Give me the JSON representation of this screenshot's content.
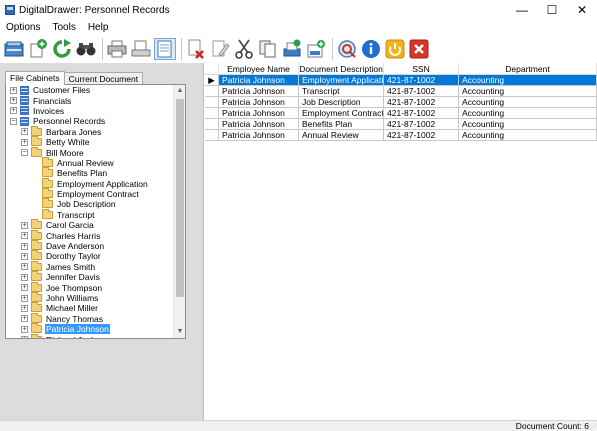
{
  "window": {
    "title": "DigitalDrawer: Personnel Records",
    "minimize": "—",
    "maximize": "☐",
    "close": "✕"
  },
  "menu": [
    "Options",
    "Tools",
    "Help"
  ],
  "toolbar": [
    {
      "name": "open-cabinet-icon",
      "group": 1
    },
    {
      "name": "add-document-icon",
      "group": 1
    },
    {
      "name": "refresh-icon",
      "group": 1
    },
    {
      "name": "binoculars-icon",
      "group": 1
    },
    {
      "name": "print-icon",
      "group": 2
    },
    {
      "name": "scan-icon",
      "group": 2
    },
    {
      "name": "view-document-icon",
      "group": 2,
      "pressed": true
    },
    {
      "name": "delete-document-icon",
      "group": 3
    },
    {
      "name": "edit-document-icon",
      "group": 3
    },
    {
      "name": "cut-icon",
      "group": 3
    },
    {
      "name": "copy-icon",
      "group": 3
    },
    {
      "name": "paste-icon",
      "group": 3
    },
    {
      "name": "add-to-drawer-icon",
      "group": 3
    },
    {
      "name": "settings-icon",
      "group": 4
    },
    {
      "name": "info-icon",
      "group": 4
    },
    {
      "name": "exit-icon",
      "group": 4
    },
    {
      "name": "close-icon",
      "group": 4
    }
  ],
  "tabs": {
    "file_cabinets": "File Cabinets",
    "current_document": "Current Document"
  },
  "tree": [
    {
      "level": 0,
      "type": "cabinet",
      "exp": "+",
      "label": "Customer Files"
    },
    {
      "level": 0,
      "type": "cabinet",
      "exp": "+",
      "label": "Financials"
    },
    {
      "level": 0,
      "type": "cabinet",
      "exp": "+",
      "label": "Invoices"
    },
    {
      "level": 0,
      "type": "cabinet",
      "exp": "−",
      "label": "Personnel Records"
    },
    {
      "level": 1,
      "type": "folder",
      "exp": "+",
      "label": "Barbara Jones"
    },
    {
      "level": 1,
      "type": "folder",
      "exp": "+",
      "label": "Betty White"
    },
    {
      "level": 1,
      "type": "folder",
      "exp": "−",
      "label": "Bill Moore"
    },
    {
      "level": 2,
      "type": "folder",
      "exp": "",
      "label": "Annual Review"
    },
    {
      "level": 2,
      "type": "folder",
      "exp": "",
      "label": "Benefits Plan"
    },
    {
      "level": 2,
      "type": "folder",
      "exp": "",
      "label": "Employment Application"
    },
    {
      "level": 2,
      "type": "folder",
      "exp": "",
      "label": "Employment Contract"
    },
    {
      "level": 2,
      "type": "folder",
      "exp": "",
      "label": "Job Description"
    },
    {
      "level": 2,
      "type": "folder",
      "exp": "",
      "label": "Transcript"
    },
    {
      "level": 1,
      "type": "folder",
      "exp": "+",
      "label": "Carol Garcia"
    },
    {
      "level": 1,
      "type": "folder",
      "exp": "+",
      "label": "Charles Harris"
    },
    {
      "level": 1,
      "type": "folder",
      "exp": "+",
      "label": "Dave Anderson"
    },
    {
      "level": 1,
      "type": "folder",
      "exp": "+",
      "label": "Dorothy Taylor"
    },
    {
      "level": 1,
      "type": "folder",
      "exp": "+",
      "label": "James Smith"
    },
    {
      "level": 1,
      "type": "folder",
      "exp": "+",
      "label": "Jennifer Davis"
    },
    {
      "level": 1,
      "type": "folder",
      "exp": "+",
      "label": "Joe Thompson"
    },
    {
      "level": 1,
      "type": "folder",
      "exp": "+",
      "label": "John Williams"
    },
    {
      "level": 1,
      "type": "folder",
      "exp": "+",
      "label": "Michael Miller"
    },
    {
      "level": 1,
      "type": "folder",
      "exp": "+",
      "label": "Nancy Thomas"
    },
    {
      "level": 1,
      "type": "folder",
      "exp": "+",
      "label": "Patricia Johnson",
      "selected": true
    },
    {
      "level": 1,
      "type": "folder",
      "exp": "+",
      "label": "Richard Jackson"
    }
  ],
  "scroll": {
    "up": "▲",
    "down": "▼"
  },
  "grid": {
    "columns": [
      "Employee Name",
      "Document Description",
      "SSN",
      "Department"
    ],
    "current_row_marker": "▶",
    "rows": [
      [
        "Patricia Johnson",
        "Employment Application",
        "421-87-1002",
        "Accounting"
      ],
      [
        "Patricia Johnson",
        "Transcript",
        "421-87-1002",
        "Accounting"
      ],
      [
        "Patricia Johnson",
        "Job Description",
        "421-87-1002",
        "Accounting"
      ],
      [
        "Patricia Johnson",
        "Employment Contract",
        "421-87-1002",
        "Accounting"
      ],
      [
        "Patricia Johnson",
        "Benefits Plan",
        "421-87-1002",
        "Accounting"
      ],
      [
        "Patricia Johnson",
        "Annual Review",
        "421-87-1002",
        "Accounting"
      ]
    ]
  },
  "status": {
    "document_count": "Document Count: 6"
  },
  "colors": {
    "selection": "#0078d7",
    "tree_selection": "#3399ff",
    "panel_bg": "#dcdcdc"
  }
}
